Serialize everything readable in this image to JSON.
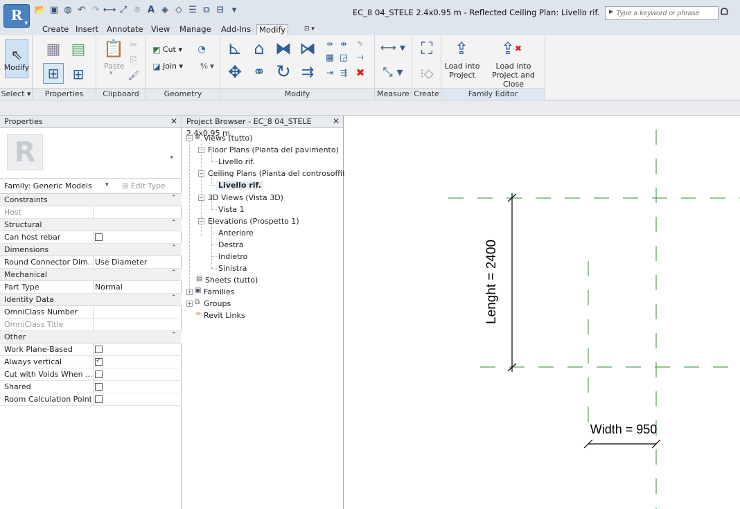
{
  "app": {
    "logo_text": "R",
    "document_title": "EC_8 04_STELE 2.4x0.95 m - Reflected Ceiling Plan: Livello rif.",
    "search_placeholder": "Type a keyword or phrase"
  },
  "ribbon_tabs": [
    "Create",
    "Insert",
    "Annotate",
    "View",
    "Manage",
    "Add-Ins",
    "Modify"
  ],
  "active_tab": "Modify",
  "panels": {
    "select": {
      "title": "Select",
      "modify_label": "Modify"
    },
    "properties": {
      "title": "Properties"
    },
    "clipboard": {
      "title": "Clipboard",
      "paste_label": "Paste"
    },
    "geometry": {
      "title": "Geometry",
      "cut_label": "Cut",
      "join_label": "Join"
    },
    "modify": {
      "title": "Modify"
    },
    "measure": {
      "title": "Measure"
    },
    "create": {
      "title": "Create"
    },
    "family_editor": {
      "title": "Family Editor",
      "load_into_project_label_1": "Load into",
      "load_into_project_label_2": "Project",
      "load_close_label_1": "Load into",
      "load_close_label_2": "Project and Close"
    }
  },
  "properties_pane": {
    "title": "Properties",
    "family_label": "Family: Generic Models",
    "edit_type_label": "Edit Type",
    "rows": [
      {
        "type": "category",
        "name": "Constraints"
      },
      {
        "type": "param",
        "name": "Host",
        "value": "",
        "dim": true
      },
      {
        "type": "category",
        "name": "Structural"
      },
      {
        "type": "param",
        "name": "Can host rebar",
        "checkbox": false
      },
      {
        "type": "category",
        "name": "Dimensions"
      },
      {
        "type": "param",
        "name": "Round Connector Dim...",
        "value": "Use Diameter"
      },
      {
        "type": "category",
        "name": "Mechanical"
      },
      {
        "type": "param",
        "name": "Part Type",
        "value": "Normal"
      },
      {
        "type": "category",
        "name": "Identity Data"
      },
      {
        "type": "param",
        "name": "OmniClass Number",
        "value": ""
      },
      {
        "type": "param",
        "name": "OmniClass Title",
        "value": "",
        "dim": true
      },
      {
        "type": "category",
        "name": "Other"
      },
      {
        "type": "param",
        "name": "Work Plane-Based",
        "checkbox": false
      },
      {
        "type": "param",
        "name": "Always vertical",
        "checkbox": true
      },
      {
        "type": "param",
        "name": "Cut with Voids When ...",
        "checkbox": false
      },
      {
        "type": "param",
        "name": "Shared",
        "checkbox": false
      },
      {
        "type": "param",
        "name": "Room Calculation Point",
        "checkbox": false
      }
    ]
  },
  "project_browser": {
    "title": "Project Browser - EC_8 04_STELE 2.4x0.95 m",
    "nodes": {
      "views": "Views (tutto)",
      "floor_plans": "Floor Plans (Pianta del pavimento)",
      "floor_livello": "Livello rif.",
      "ceiling_plans": "Ceiling Plans (Pianta del controsoffitto",
      "ceiling_livello": "Livello rif.",
      "views_3d": "3D Views (Vista 3D)",
      "vista1": "Vista 1",
      "elevations": "Elevations (Prospetto 1)",
      "anteriore": "Anteriore",
      "destra": "Destra",
      "indietro": "Indietro",
      "sinistra": "Sinistra",
      "sheets": "Sheets (tutto)",
      "families": "Families",
      "groups": "Groups",
      "revit_links": "Revit Links"
    }
  },
  "drawing": {
    "length_label": "Lenght = 2400",
    "width_label": "Width = 950",
    "colors": {
      "reference_plane": "#2e8b2e",
      "dimension": "#000000"
    }
  }
}
